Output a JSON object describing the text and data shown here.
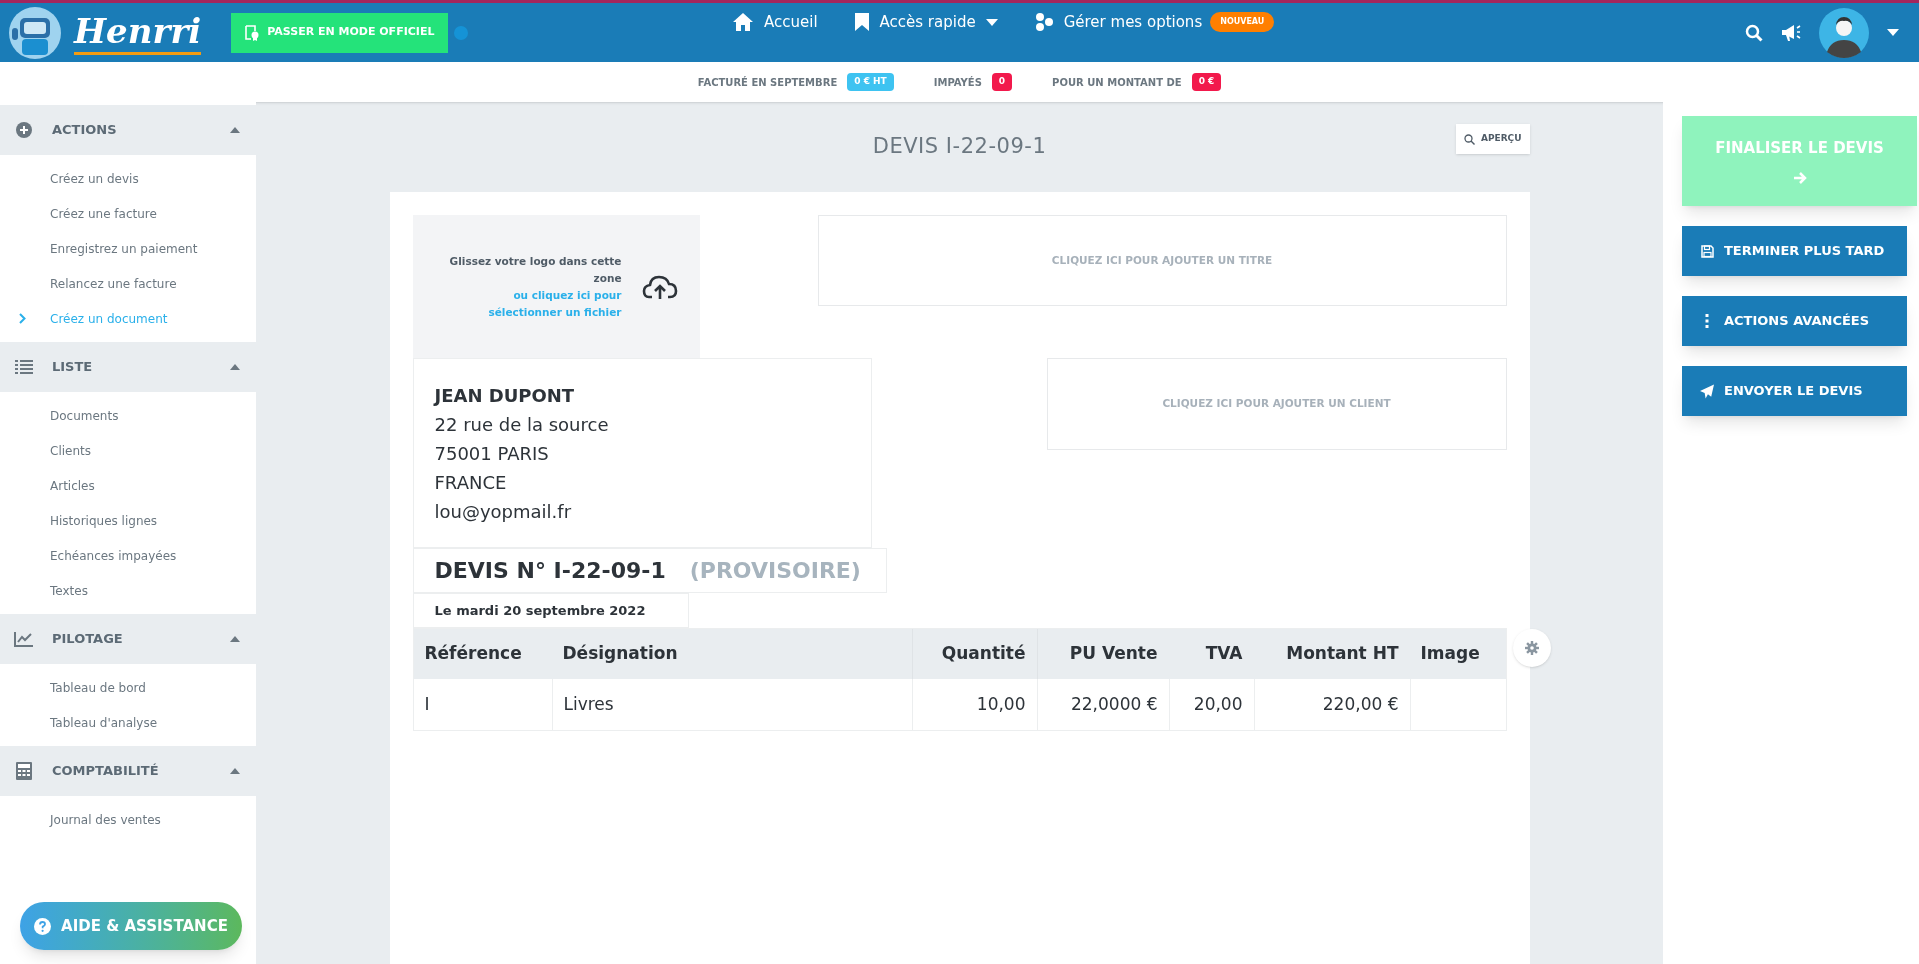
{
  "header": {
    "brand": "Henrri",
    "mode_button": "PASSER EN MODE OFFICIEL",
    "nav": [
      {
        "label": "Accueil",
        "dropdown": false
      },
      {
        "label": "Accès rapide",
        "dropdown": true
      },
      {
        "label": "Gérer mes options",
        "dropdown": false,
        "badge": "NOUVEAU"
      }
    ]
  },
  "stats": [
    {
      "label": "FACTURÉ EN SEPTEMBRE",
      "value": "0 € HT",
      "color": "#3ec3f1"
    },
    {
      "label": "IMPAYÉS",
      "value": "0",
      "color": "#f2194c"
    },
    {
      "label": "POUR UN MONTANT DE",
      "value": "0 €",
      "color": "#f2194c"
    }
  ],
  "sidebar": {
    "sections": [
      {
        "title": "ACTIONS",
        "expanded": true,
        "items": [
          {
            "label": "Créez un devis",
            "selected": false
          },
          {
            "label": "Créez une facture",
            "selected": false
          },
          {
            "label": "Enregistrez un paiement",
            "selected": false
          },
          {
            "label": "Relancez une facture",
            "selected": false
          },
          {
            "label": "Créez un document",
            "selected": true
          }
        ]
      },
      {
        "title": "LISTE",
        "expanded": true,
        "items": [
          {
            "label": "Documents",
            "selected": false
          },
          {
            "label": "Clients",
            "selected": false
          },
          {
            "label": "Articles",
            "selected": false
          },
          {
            "label": "Historiques lignes",
            "selected": false
          },
          {
            "label": "Echéances impayées",
            "selected": false
          },
          {
            "label": "Textes",
            "selected": false
          }
        ]
      },
      {
        "title": "PILOTAGE",
        "expanded": true,
        "items": [
          {
            "label": "Tableau de bord",
            "selected": false
          },
          {
            "label": "Tableau d'analyse",
            "selected": false
          }
        ]
      },
      {
        "title": "COMPTABILITÉ",
        "expanded": true,
        "items": [
          {
            "label": "Journal des ventes",
            "selected": false
          }
        ]
      }
    ],
    "help_button": "AIDE & ASSISTANCE"
  },
  "page_title": "DEVIS I-22-09-1",
  "preview_button": "APERÇU",
  "document": {
    "logo_zone": {
      "text": "Glissez votre logo dans cette zone",
      "link": "ou cliquez ici pour sélectionner un fichier"
    },
    "title_placeholder": "CLIQUEZ ICI POUR AJOUTER UN TITRE",
    "sender": [
      "JEAN DUPONT",
      "22 rue de la source",
      "75001 PARIS",
      "FRANCE",
      "lou@yopmail.fr"
    ],
    "client_placeholder": "CLIQUEZ ICI POUR AJOUTER UN CLIENT",
    "number": "DEVIS N° I-22-09-1",
    "status": "(PROVISOIRE)",
    "date": "Le mardi 20 septembre 2022",
    "table": {
      "columns": [
        "Référence",
        "Désignation",
        "Quantité",
        "PU Vente",
        "TVA",
        "Montant HT",
        "Image"
      ],
      "rows": [
        [
          "I",
          "Livres",
          "10,00",
          "22,0000 €",
          "20,00",
          "220,00 €",
          ""
        ]
      ]
    }
  },
  "actions": [
    {
      "label": "FINALISER LE DEVIS",
      "kind": "primary",
      "disabled": true
    },
    {
      "label": "TERMINER PLUS TARD",
      "kind": "secondary",
      "disabled": false
    },
    {
      "label": "ACTIONS AVANCÉES",
      "kind": "secondary",
      "disabled": false
    },
    {
      "label": "ENVOYER LE DEVIS",
      "kind": "secondary",
      "disabled": false
    }
  ]
}
